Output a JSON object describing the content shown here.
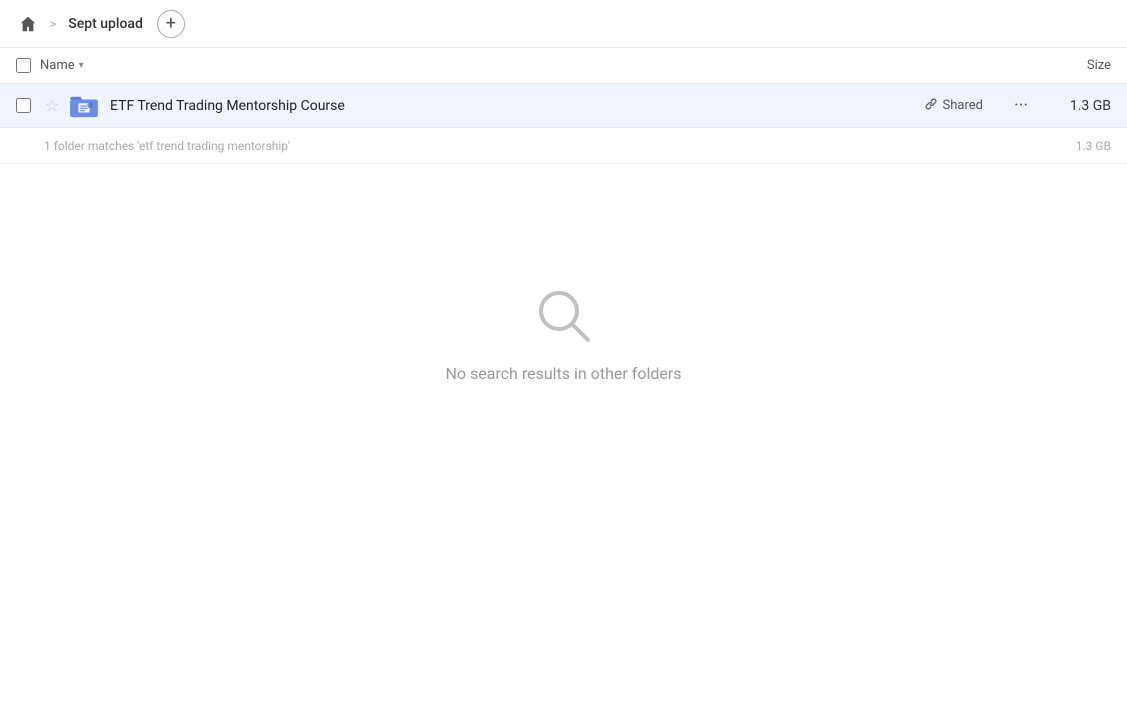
{
  "header": {
    "home_icon": "home-icon",
    "breadcrumb_separator": ">",
    "tab_label": "Sept upload",
    "add_tab_icon": "+"
  },
  "column_headers": {
    "name_label": "Name",
    "size_label": "Size",
    "chevron": "▾"
  },
  "file_row": {
    "star_icon": "☆",
    "file_name": "ETF Trend Trading Mentorship Course",
    "shared_label": "Shared",
    "more_icon": "···",
    "size": "1.3 GB"
  },
  "search_info": {
    "text": "1 folder matches 'etf trend trading mentorship'",
    "size": "1.3 GB"
  },
  "empty_state": {
    "message": "No search results in other folders"
  }
}
